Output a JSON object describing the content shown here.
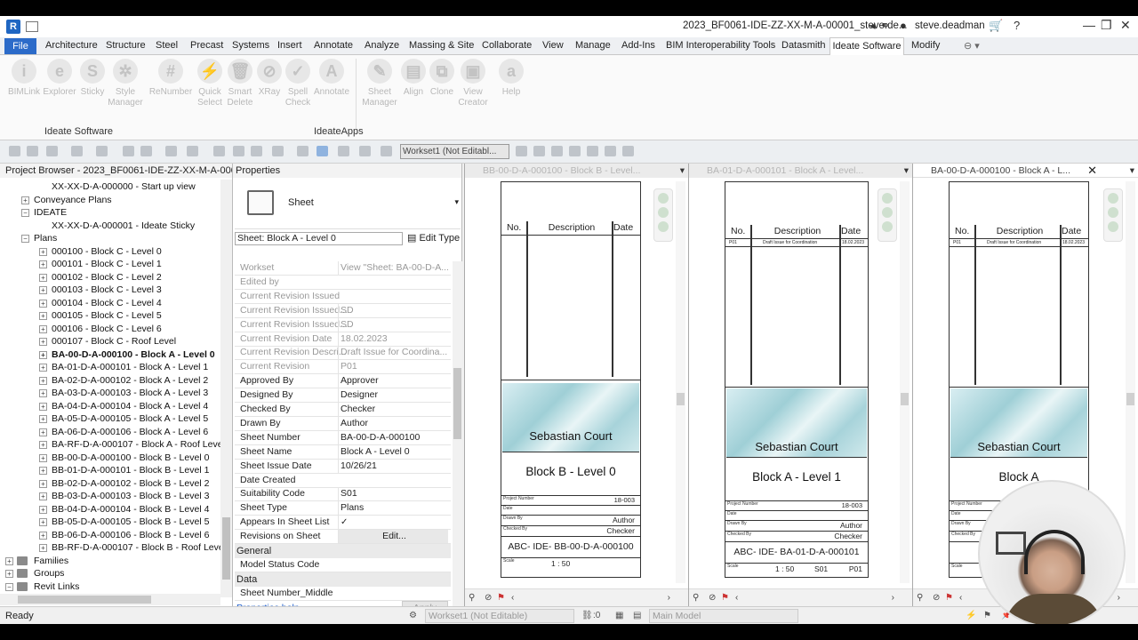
{
  "titlebar": {
    "app_icon": "R",
    "document_title": "2023_BF0061-IDE-ZZ-XX-M-A-00001_steve.de...",
    "user": "steve.deadman",
    "icons": [
      "binoculars-icon",
      "user-icon",
      "cart-icon",
      "help-icon",
      "minimize-icon",
      "restore-icon",
      "close-icon"
    ]
  },
  "ribbon_tabs": [
    "File",
    "Architecture",
    "Structure",
    "Steel",
    "Precast",
    "Systems",
    "Insert",
    "Annotate",
    "Analyze",
    "Massing & Site",
    "Collaborate",
    "View",
    "Manage",
    "Add-Ins",
    "BIM Interoperability Tools",
    "Datasmith",
    "Ideate Software",
    "Modify"
  ],
  "active_tab": "Ideate Software",
  "ribbon_tools": [
    {
      "label": "BIMLink"
    },
    {
      "label": "Explorer"
    },
    {
      "label": "Sticky"
    },
    {
      "label": "Style Manager"
    },
    {
      "label": "ReNumber"
    },
    {
      "label": "Quick Select"
    },
    {
      "label": "Smart Delete"
    },
    {
      "label": "XRay"
    },
    {
      "label": "Spell Check"
    },
    {
      "label": "Annotate"
    },
    {
      "label": "Sheet Manager"
    },
    {
      "label": "Align"
    },
    {
      "label": "Clone"
    },
    {
      "label": "View Creator"
    },
    {
      "label": "Help"
    }
  ],
  "ribbon_panels": [
    "Ideate Software",
    "IdeateApps"
  ],
  "quick_access": {
    "workset": "Workset1 (Not Editabl..."
  },
  "project_browser": {
    "title": "Project Browser - 2023_BF0061-IDE-ZZ-XX-M-A-00001...",
    "rows": [
      {
        "label": "XX-XX-D-A-000000 - Start up view",
        "indent": 2,
        "exp": "",
        "bold": false
      },
      {
        "label": "Conveyance Plans",
        "indent": 1,
        "exp": "+",
        "bold": false
      },
      {
        "label": "IDEATE",
        "indent": 1,
        "exp": "-",
        "bold": false
      },
      {
        "label": "XX-XX-D-A-000001 - Ideate Sticky",
        "indent": 2,
        "exp": "",
        "bold": false
      },
      {
        "label": "Plans",
        "indent": 1,
        "exp": "-",
        "bold": false
      },
      {
        "label": "000100 - Block C - Level 0",
        "indent": 2,
        "exp": "+",
        "bold": false
      },
      {
        "label": "000101 - Block C - Level 1",
        "indent": 2,
        "exp": "+",
        "bold": false
      },
      {
        "label": "000102 - Block C - Level 2",
        "indent": 2,
        "exp": "+",
        "bold": false
      },
      {
        "label": "000103 - Block C - Level 3",
        "indent": 2,
        "exp": "+",
        "bold": false
      },
      {
        "label": "000104 - Block C - Level 4",
        "indent": 2,
        "exp": "+",
        "bold": false
      },
      {
        "label": "000105 - Block C - Level 5",
        "indent": 2,
        "exp": "+",
        "bold": false
      },
      {
        "label": "000106 - Block C - Level 6",
        "indent": 2,
        "exp": "+",
        "bold": false
      },
      {
        "label": "000107 - Block C - Roof Level",
        "indent": 2,
        "exp": "+",
        "bold": false
      },
      {
        "label": "BA-00-D-A-000100 - Block A - Level 0",
        "indent": 2,
        "exp": "+",
        "bold": true
      },
      {
        "label": "BA-01-D-A-000101 - Block A - Level 1",
        "indent": 2,
        "exp": "+",
        "bold": false
      },
      {
        "label": "BA-02-D-A-000102 - Block A - Level 2",
        "indent": 2,
        "exp": "+",
        "bold": false
      },
      {
        "label": "BA-03-D-A-000103 - Block A - Level 3",
        "indent": 2,
        "exp": "+",
        "bold": false
      },
      {
        "label": "BA-04-D-A-000104 - Block A - Level 4",
        "indent": 2,
        "exp": "+",
        "bold": false
      },
      {
        "label": "BA-05-D-A-000105 - Block A - Level 5",
        "indent": 2,
        "exp": "+",
        "bold": false
      },
      {
        "label": "BA-06-D-A-000106 - Block A - Level 6",
        "indent": 2,
        "exp": "+",
        "bold": false
      },
      {
        "label": "BA-RF-D-A-000107 - Block A - Roof Level",
        "indent": 2,
        "exp": "+",
        "bold": false
      },
      {
        "label": "BB-00-D-A-000100 - Block B - Level 0",
        "indent": 2,
        "exp": "+",
        "bold": false
      },
      {
        "label": "BB-01-D-A-000101 - Block B - Level 1",
        "indent": 2,
        "exp": "+",
        "bold": false
      },
      {
        "label": "BB-02-D-A-000102 - Block B - Level 2",
        "indent": 2,
        "exp": "+",
        "bold": false
      },
      {
        "label": "BB-03-D-A-000103 - Block B - Level 3",
        "indent": 2,
        "exp": "+",
        "bold": false
      },
      {
        "label": "BB-04-D-A-000104 - Block B - Level 4",
        "indent": 2,
        "exp": "+",
        "bold": false
      },
      {
        "label": "BB-05-D-A-000105 - Block B - Level 5",
        "indent": 2,
        "exp": "+",
        "bold": false
      },
      {
        "label": "BB-06-D-A-000106 - Block B - Level 6",
        "indent": 2,
        "exp": "+",
        "bold": false
      },
      {
        "label": "BB-RF-D-A-000107 - Block B - Roof Level",
        "indent": 2,
        "exp": "+",
        "bold": false
      },
      {
        "label": "Families",
        "indent": 0,
        "exp": "+",
        "bold": false
      },
      {
        "label": "Groups",
        "indent": 0,
        "exp": "+",
        "bold": false
      },
      {
        "label": "Revit Links",
        "indent": 0,
        "exp": "-",
        "bold": false
      }
    ]
  },
  "properties": {
    "title": "Properties",
    "type_name": "Sheet",
    "filter": "Sheet: Block A - Level 0",
    "edit_type": "Edit Type",
    "rows": [
      {
        "k": "Workset",
        "v": "View \"Sheet: BA-00-D-A...",
        "dis": true
      },
      {
        "k": "Edited by",
        "v": "",
        "dis": true
      },
      {
        "k": "Current Revision Issued",
        "v": "",
        "dis": true
      },
      {
        "k": "Current Revision Issued...",
        "v": "SD",
        "dis": true
      },
      {
        "k": "Current Revision Issued...",
        "v": "SD",
        "dis": true
      },
      {
        "k": "Current Revision Date",
        "v": "18.02.2023",
        "dis": true
      },
      {
        "k": "Current Revision Descri...",
        "v": "Draft Issue for Coordina...",
        "dis": true
      },
      {
        "k": "Current Revision",
        "v": "P01",
        "dis": true
      },
      {
        "k": "Approved By",
        "v": "Approver",
        "dis": false
      },
      {
        "k": "Designed By",
        "v": "Designer",
        "dis": false
      },
      {
        "k": "Checked By",
        "v": "Checker",
        "dis": false
      },
      {
        "k": "Drawn By",
        "v": "Author",
        "dis": false
      },
      {
        "k": "Sheet Number",
        "v": "BA-00-D-A-000100",
        "dis": false
      },
      {
        "k": "Sheet Name",
        "v": "Block A - Level 0",
        "dis": false
      },
      {
        "k": "Sheet Issue Date",
        "v": "10/26/21",
        "dis": false
      },
      {
        "k": "Date Created",
        "v": "",
        "dis": false
      },
      {
        "k": "Suitability Code",
        "v": "S01",
        "dis": false
      },
      {
        "k": "Sheet Type",
        "v": "Plans",
        "dis": false
      },
      {
        "k": "Appears In Sheet List",
        "v": "✓",
        "dis": false
      },
      {
        "k": "Revisions on Sheet",
        "v": "Edit...",
        "dis": false
      }
    ],
    "group_general": "General",
    "model_status": "Model Status Code",
    "group_data": "Data",
    "sheet_number_middle": "Sheet Number_Middle",
    "help": "Properties help",
    "apply": "Apply"
  },
  "views": [
    {
      "tab": "BB-00-D-A-000100 - Block B - Level...",
      "project": "Sebastian Court",
      "sheet_title": "Block B - Level 0",
      "project_number": "18-003",
      "drawn": "Author",
      "checked": "Checker",
      "code": "ABC- IDE- BB-00-D-A-000100",
      "scale": "1 : 50",
      "rev_row": ""
    },
    {
      "tab": "BA-01-D-A-000101 - Block A - Level...",
      "project": "Sebastian Court",
      "sheet_title": "Block A - Level 1",
      "project_number": "18-003",
      "drawn": "Author",
      "checked": "Checker",
      "code": "ABC- IDE- BA-01-D-A-000101",
      "scale": "1 : 50",
      "suit": "S01",
      "rev": "P01",
      "rev_row": "P01"
    },
    {
      "tab": "BA-00-D-A-000100 - Block A - L...",
      "project": "Sebastian Court",
      "sheet_title": "Block A",
      "project_number": "",
      "drawn": "",
      "checked": "",
      "code": "ABC",
      "scale": "",
      "rev_row": "P01"
    }
  ],
  "rev_header": {
    "no": "No.",
    "desc": "Description",
    "date": "Date",
    "row_desc": "Draft Issue for Coordination",
    "row_date": "18.02.2023"
  },
  "titleblock_labels": {
    "project_number": "Project Number",
    "date": "Date",
    "drawn_by": "Drawn By",
    "checked_by": "Checked By",
    "scale": "Scale"
  },
  "status": {
    "ready": "Ready",
    "workset": "Workset1 (Not Editable)",
    "zero": ":0",
    "model": "Main Model"
  }
}
